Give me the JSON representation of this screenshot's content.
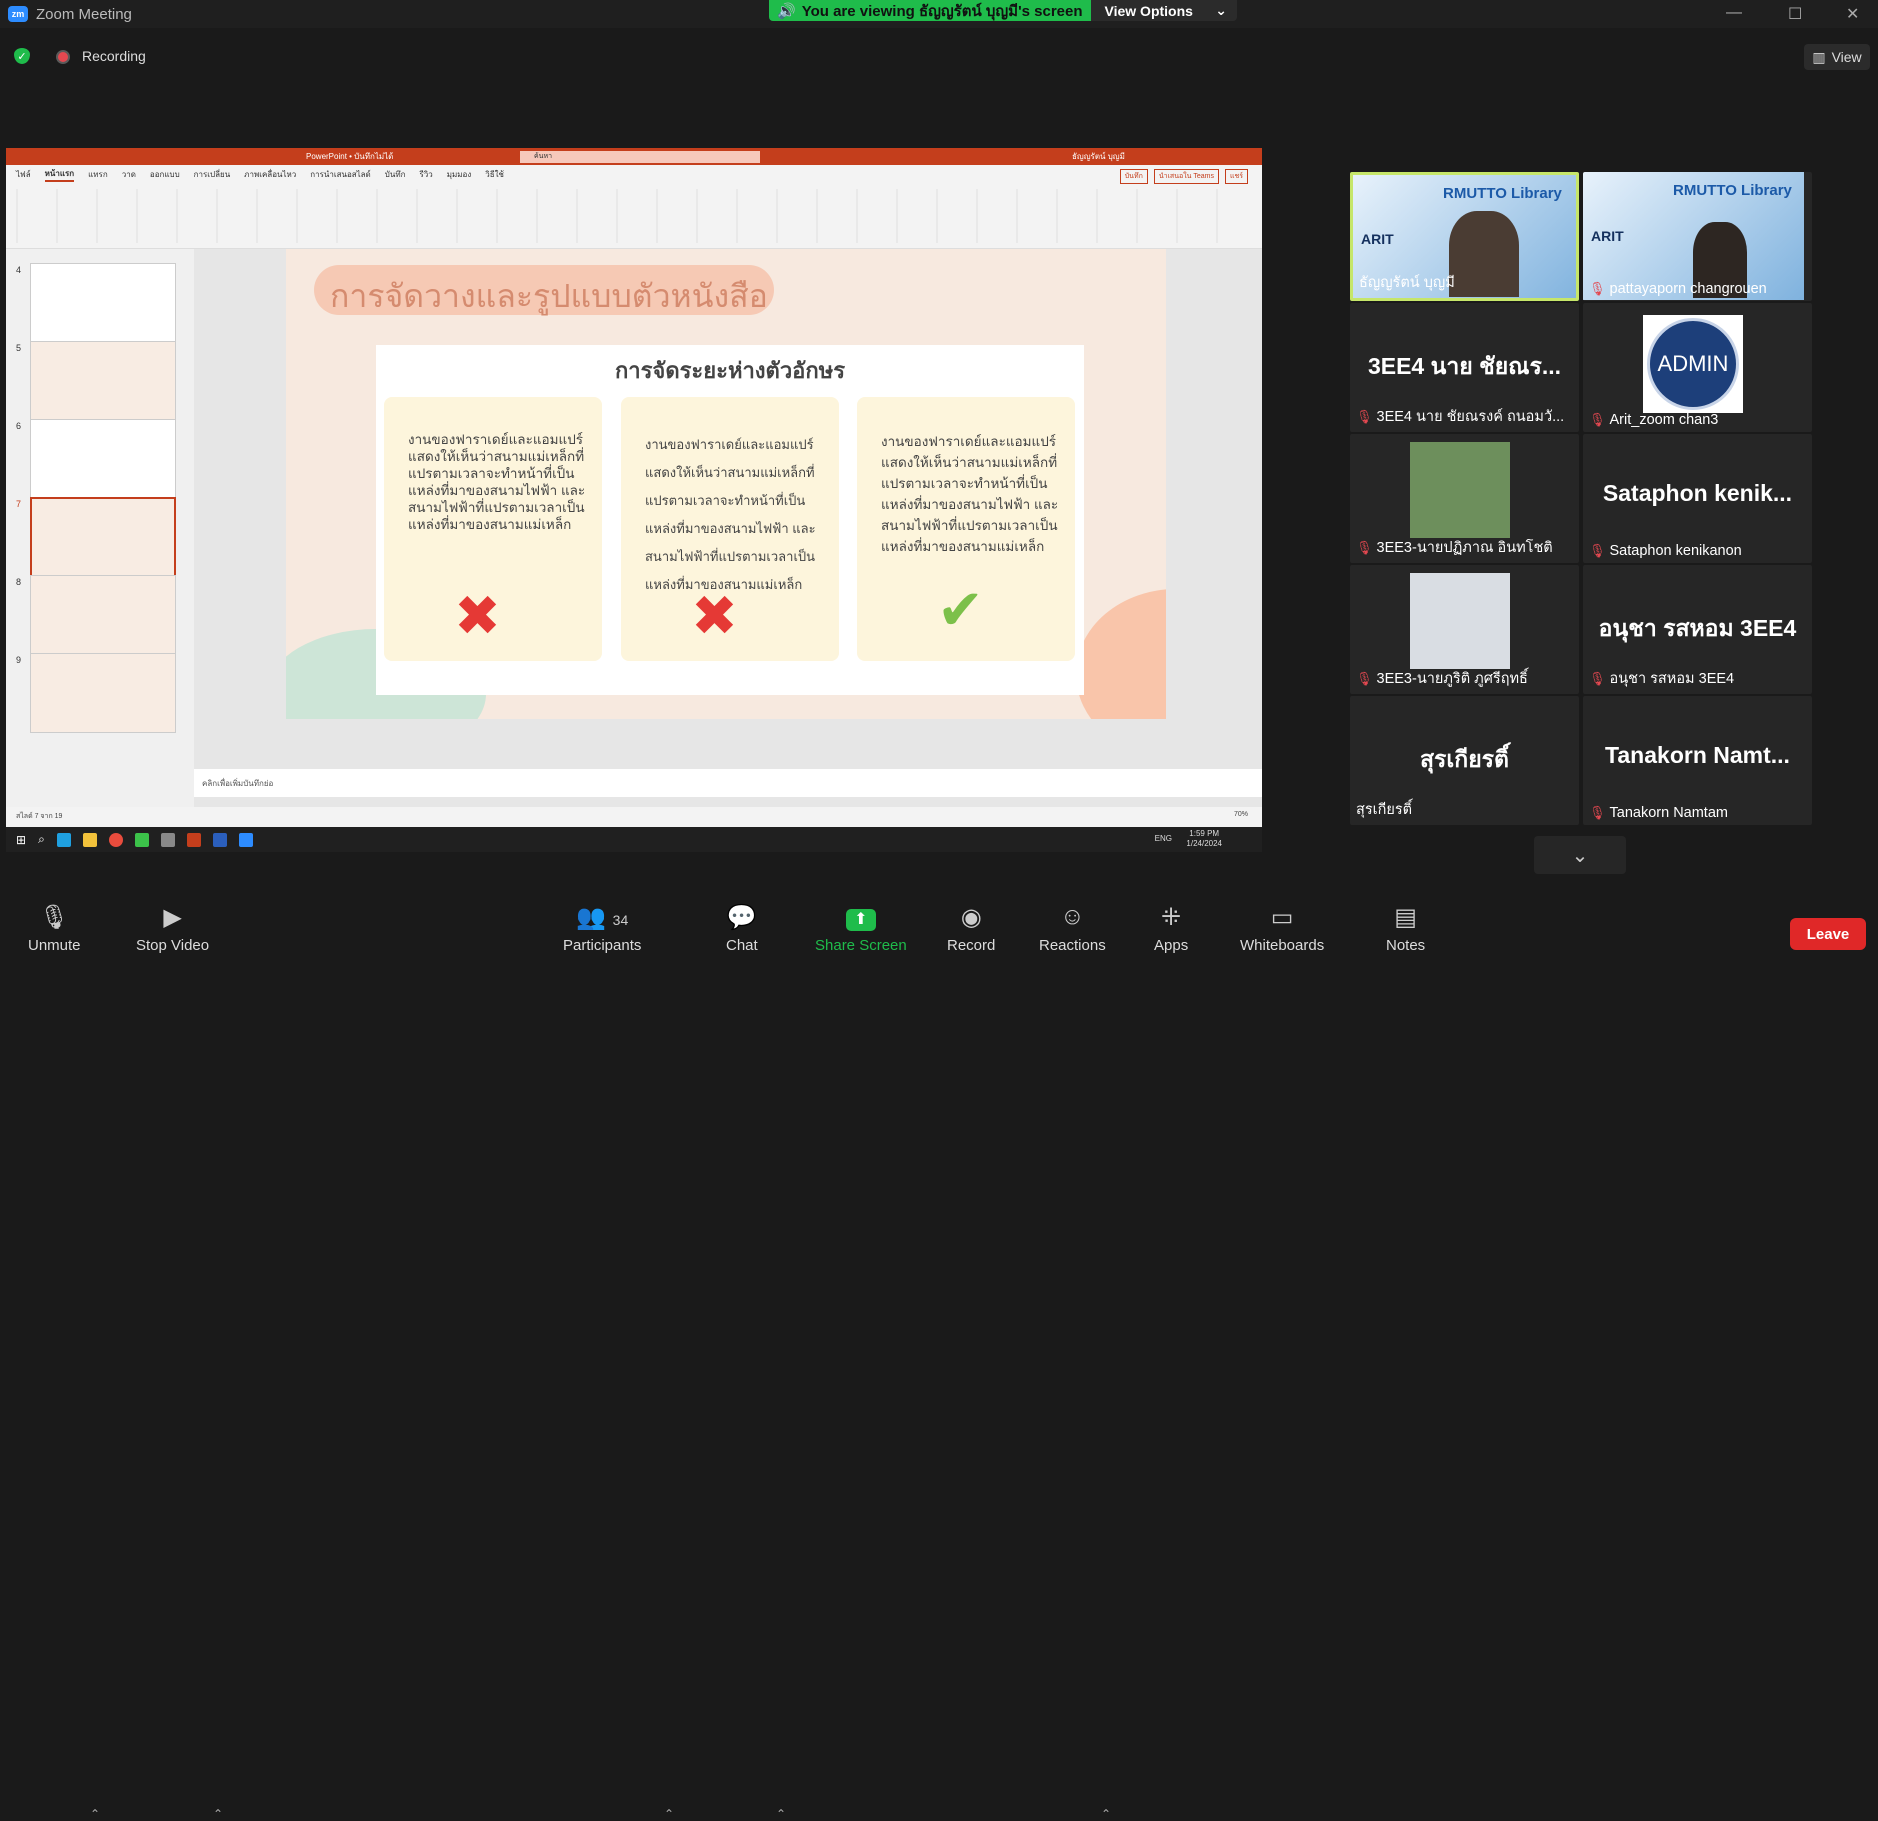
{
  "window": {
    "title": "Zoom Meeting",
    "logo": "zm"
  },
  "banner": {
    "viewing": "You are viewing ธัญญรัตน์ บุญมี's screen",
    "view_options": "View Options"
  },
  "status": {
    "recording": "Recording",
    "view": "View"
  },
  "powerpoint": {
    "titlebar": "PowerPoint • บันทึกไม่ได้",
    "search": "ค้นหา",
    "user": "ธัญญรัตน์ บุญมี",
    "tabs": [
      "ไฟล์",
      "หน้าแรก",
      "แทรก",
      "วาด",
      "ออกแบบ",
      "การเปลี่ยน",
      "ภาพเคลื่อนไหว",
      "การนำเสนอสไลด์",
      "บันทึก",
      "รีวิว",
      "มุมมอง",
      "วิธีใช้"
    ],
    "ribbon_right": [
      "บันทึก",
      "นำเสนอใน Teams",
      "แชร์"
    ],
    "thumbs": [
      "4",
      "5",
      "6",
      "7",
      "8",
      "9"
    ],
    "slide": {
      "title": "การจัดวางและรูปแบบตัวหนังสือ",
      "subtitle": "การจัดระยะห่างตัวอักษร",
      "cards": [
        "งานของฟาราเดย์และแอมแปร์แสดงให้เห็นว่าสนามแม่เหล็กที่แปรตามเวลาจะทำหน้าที่เป็นแหล่งที่มาของสนามไฟฟ้า และสนามไฟฟ้าที่แปรตามเวลาเป็นแหล่งที่มาของสนามแม่เหล็ก",
        "งานของฟาราเดย์และแอมแปร์แสดงให้เห็นว่าสนามแม่เหล็กที่แปรตามเวลาจะทำหน้าที่เป็นแหล่งที่มาของสนามไฟฟ้า และสนามไฟฟ้าที่แปรตามเวลาเป็นแหล่งที่มาของสนามแม่เหล็ก",
        "งานของฟาราเดย์และแอมแปร์แสดงให้เห็นว่าสนามแม่เหล็กที่แปรตามเวลาจะทำหน้าที่เป็นแหล่งที่มาของสนามไฟฟ้า และสนามไฟฟ้าที่แปรตามเวลาเป็นแหล่งที่มาของสนามแม่เหล็ก"
      ]
    },
    "notes": "คลิกเพื่อเพิ่มบันทึกย่อ",
    "statusbar": "สไลด์ 7 จาก 19",
    "zoom": "70%",
    "clock_time": "1:59 PM",
    "clock_date": "1/24/2024",
    "lang": "ENG"
  },
  "participants_tiles": [
    {
      "name": "ธัญญรัตน์ บุญมี",
      "big": "",
      "muted": false,
      "active": true
    },
    {
      "name": "pattayaporn changrouen",
      "big": "",
      "muted": true,
      "active": false
    },
    {
      "name": "3EE4 นาย ชัยณรงค์ ถนอมวั...",
      "big": "3EE4 นาย ชัยณร...",
      "muted": true,
      "active": false
    },
    {
      "name": "Arit_zoom chan3",
      "big": "",
      "muted": true,
      "active": false
    },
    {
      "name": "3EE3-นายปฏิภาณ อินทโชติ",
      "big": "",
      "muted": true,
      "active": false
    },
    {
      "name": "Sataphon kenikanon",
      "big": "Sataphon kenik...",
      "muted": true,
      "active": false
    },
    {
      "name": "3EE3-นายภูริติ ภูศรีฤทธิ์",
      "big": "",
      "muted": true,
      "active": false
    },
    {
      "name": "อนุชา รสหอม 3EE4",
      "big": "อนุชา รสหอม 3EE4",
      "muted": true,
      "active": false
    },
    {
      "name": "สุรเกียรติ์",
      "big": "สุรเกียรติ์",
      "muted": false,
      "active": false
    },
    {
      "name": "Tanakorn Namtam",
      "big": "Tanakorn Namt...",
      "muted": true,
      "active": false
    }
  ],
  "tile_banner": {
    "library": "RMUTTO Library",
    "arit": "ARIT",
    "admin": "ADMIN"
  },
  "toolbar": {
    "unmute": "Unmute",
    "stop_video": "Stop Video",
    "participants": "Participants",
    "participant_count": "34",
    "chat": "Chat",
    "share_screen": "Share Screen",
    "record": "Record",
    "reactions": "Reactions",
    "apps": "Apps",
    "whiteboards": "Whiteboards",
    "notes": "Notes",
    "leave": "Leave"
  },
  "colors": {
    "accent_green": "#1fbc4b",
    "share_green": "#1fbc4b",
    "leave_red": "#e02828",
    "active_tile": "#c6e66a",
    "ppt_orange": "#c43e1c"
  }
}
